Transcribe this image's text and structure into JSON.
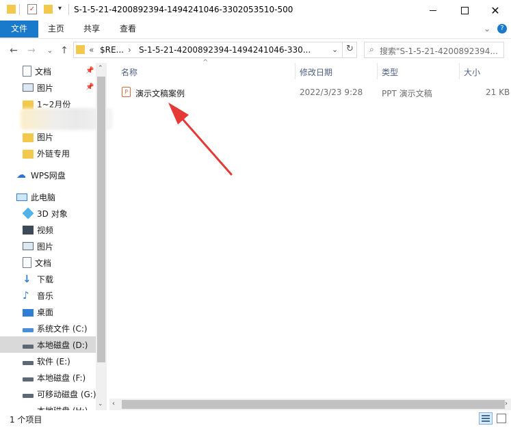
{
  "window": {
    "title": "S-1-5-21-4200892394-1494241046-3302053510-500",
    "minimize_icon": "minimize-icon",
    "maximize_icon": "maximize-icon",
    "close_icon": "close-icon"
  },
  "ribbon": {
    "tabs": [
      "文件",
      "主页",
      "共享",
      "查看"
    ],
    "accent": "#1979ca"
  },
  "address": {
    "crumbs": [
      "«",
      "$RE...",
      "›",
      "S-1-5-21-4200892394-1494241046-330..."
    ],
    "search_placeholder": "搜索\"S-1-5-21-4200892394..."
  },
  "sidebar": {
    "quick_access": [
      "文档",
      "图片",
      "1~2月份",
      "图片",
      "外链专用"
    ],
    "wps": "WPS网盘",
    "this_pc": "此电脑",
    "pc_items": [
      "3D 对象",
      "视频",
      "图片",
      "文档",
      "下载",
      "音乐",
      "桌面",
      "系统文件 (C:)",
      "本地磁盘 (D:)",
      "软件 (E:)",
      "本地磁盘 (F:)",
      "可移动磁盘 (G:)",
      "本地磁盘 (H:)"
    ]
  },
  "columns": {
    "name": "名称",
    "modified": "修改日期",
    "type": "类型",
    "size": "大小"
  },
  "files": [
    {
      "name": "演示文稿案例",
      "modified": "2022/3/23 9:28",
      "type": "PPT 演示文稿",
      "size": "21 KB"
    }
  ],
  "status": {
    "count": "1 个项目"
  },
  "annotation_color": "#e53935"
}
